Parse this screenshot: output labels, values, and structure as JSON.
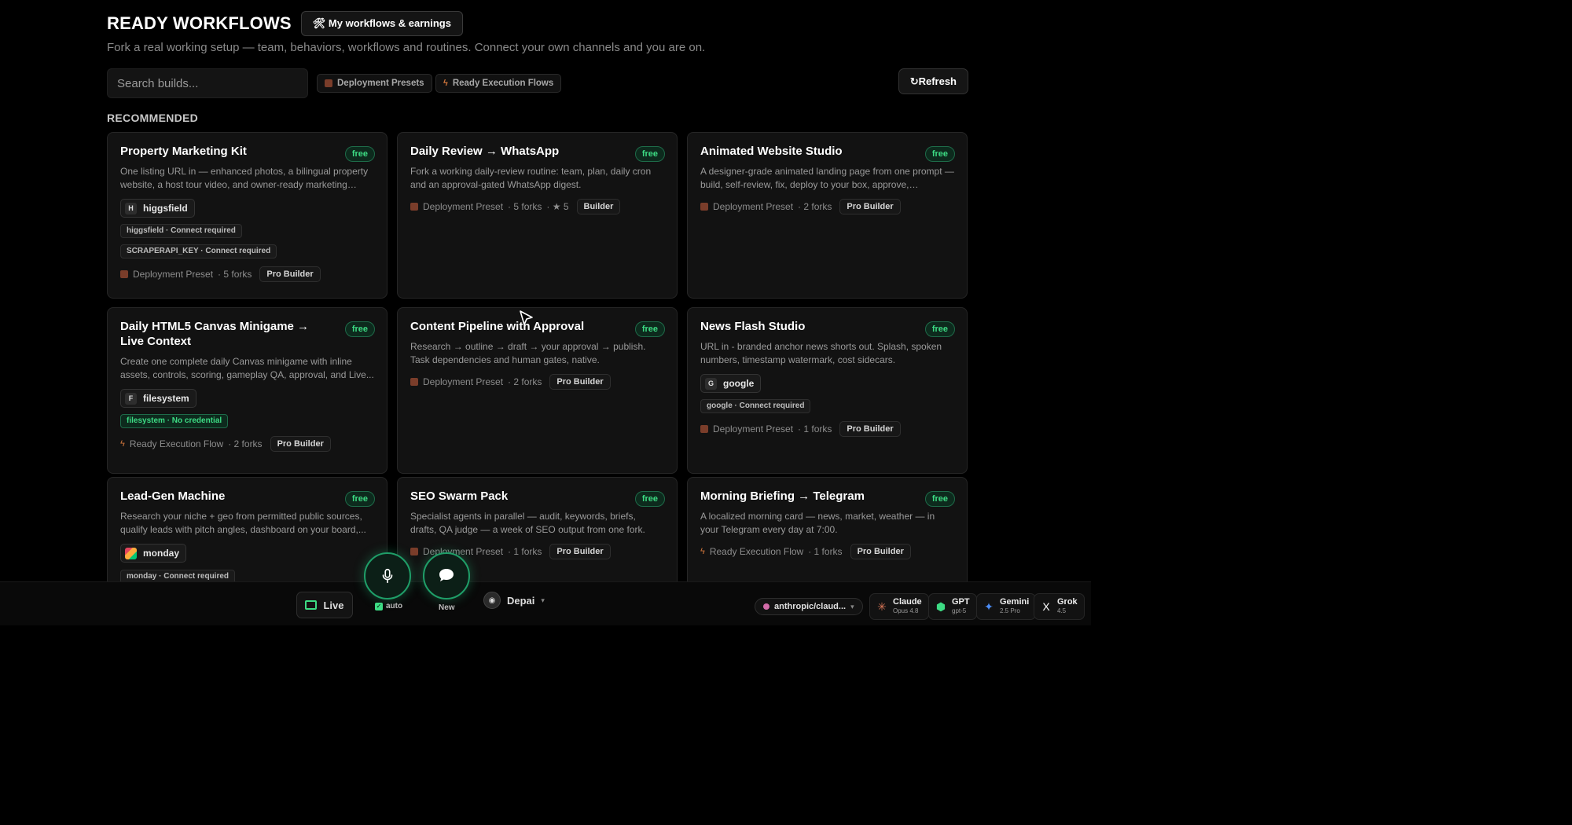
{
  "header": {
    "title": "READY WORKFLOWS",
    "my_workflows_button": "🛠 My workflows & earnings",
    "subtitle": "Fork a real working setup — team, behaviors, workflows and routines. Connect your own channels and you are on."
  },
  "toolbar": {
    "search_placeholder": "Search builds...",
    "filter_presets": "Deployment Presets",
    "filter_flows": "Ready Execution Flows",
    "refresh": "↻Refresh"
  },
  "section": {
    "label": "RECOMMENDED"
  },
  "cards": [
    {
      "title": "Property Marketing Kit",
      "badge": "free",
      "desc": "One listing URL in — enhanced photos, a bilingual property website, a host tour video, and owner-ready marketing copy...",
      "connector": {
        "letter": "H",
        "name": "higgsfield"
      },
      "requirements": [
        "higgsfield · Connect required",
        "SCRAPERAPI_KEY · Connect required"
      ],
      "type": "Deployment Preset",
      "forks": "· 5 forks",
      "stars": "",
      "tier": "Pro Builder"
    },
    {
      "title": "Daily Review → WhatsApp",
      "badge": "free",
      "desc": "Fork a working daily-review routine: team, plan, daily cron and an approval-gated WhatsApp digest.",
      "type": "Deployment Preset",
      "forks": "· 5 forks",
      "stars": "· ★ 5",
      "tier": "Builder"
    },
    {
      "title": "Animated Website Studio",
      "badge": "free",
      "desc": "A designer-grade animated landing page from one prompt — build, self-review, fix, deploy to your box, approve, optionall...",
      "type": "Deployment Preset",
      "forks": "· 2 forks",
      "stars": "",
      "tier": "Pro Builder"
    },
    {
      "title": "Daily HTML5 Canvas Minigame → Live Context",
      "badge": "free",
      "desc": "Create one complete daily Canvas minigame with inline assets, controls, scoring, gameplay QA, approval, and Live...",
      "connector": {
        "letter": "F",
        "name": "filesystem"
      },
      "requirements_ok": [
        "filesystem · No credential"
      ],
      "type": "Ready Execution Flow",
      "forks": "· 2 forks",
      "stars": "",
      "tier": "Pro Builder"
    },
    {
      "title": "Content Pipeline with Approval",
      "badge": "free",
      "desc": "Research → outline → draft → your approval → publish. Task dependencies and human gates, native.",
      "type": "Deployment Preset",
      "forks": "· 2 forks",
      "stars": "",
      "tier": "Pro Builder"
    },
    {
      "title": "News Flash Studio",
      "badge": "free",
      "desc": "URL in - branded anchor news shorts out. Splash, spoken numbers, timestamp watermark, cost sidecars.",
      "connector": {
        "letter": "G",
        "name": "google"
      },
      "requirements": [
        "google · Connect required"
      ],
      "type": "Deployment Preset",
      "forks": "· 1 forks",
      "stars": "",
      "tier": "Pro Builder"
    },
    {
      "title": "Lead-Gen Machine",
      "badge": "free",
      "desc": "Research your niche + geo from permitted public sources, qualify leads with pitch angles, dashboard on your board,...",
      "connector": {
        "letter": "",
        "name": "monday"
      },
      "requirements": [
        "monday · Connect required"
      ],
      "type": "",
      "forks": "",
      "stars": "",
      "tier": ""
    },
    {
      "title": "SEO Swarm Pack",
      "badge": "free",
      "desc": "Specialist agents in parallel — audit, keywords, briefs, drafts, QA judge — a week of SEO output from one fork.",
      "type": "Deployment Preset",
      "forks": "· 1 forks",
      "stars": "",
      "tier": "Pro Builder"
    },
    {
      "title": "Morning Briefing → Telegram",
      "badge": "free",
      "desc": "A localized morning card — news, market, weather — in your Telegram every day at 7:00.",
      "type": "Ready Execution Flow",
      "forks": "· 1 forks",
      "stars": "",
      "tier": "Pro Builder"
    }
  ],
  "bottom_bar": {
    "live": "Live",
    "auto": "auto",
    "new": "New",
    "persona": "Depai",
    "model": "anthropic/claud...",
    "providers": [
      {
        "icon": "✳",
        "name": "Claude",
        "sub": "Opus 4.8",
        "color": "#d97757"
      },
      {
        "icon": "⬢",
        "name": "GPT",
        "sub": "gpt-5",
        "color": "#3ddc84"
      },
      {
        "icon": "✦",
        "name": "Gemini",
        "sub": "2.5 Pro",
        "color": "#4b8cf5"
      },
      {
        "icon": "X",
        "name": "Grok",
        "sub": "4.5",
        "color": "#ffffff"
      }
    ]
  }
}
